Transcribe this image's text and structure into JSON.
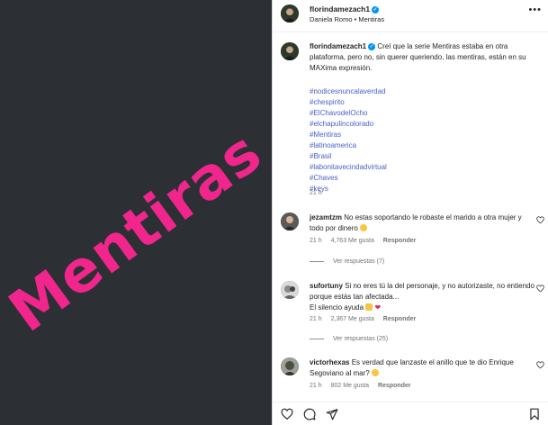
{
  "image_text": "Mentiras",
  "post": {
    "username": "florindamezach1",
    "subtitle": "Daniela Romo • Mentiras",
    "more": "•••"
  },
  "caption": {
    "username": "florindamezach1",
    "text": "Creí que la serie Mentiras estaba en otra plataforma, pero no, sin querer queriendo, las mentiras, están en su MAXima expresión.",
    "hashtags": [
      "#nodicesnuncalaverdad",
      "#chespirito",
      "#ElChavodelOcho",
      "#elchapulincolorado",
      "#Mentiras",
      "#latinoamerica",
      "#Brasil",
      "#labonitavecindadvirtual",
      "#Chaves",
      "#keys"
    ],
    "time": "21 h"
  },
  "comments": [
    {
      "username": "jezamtzm",
      "text": "No estas soportando le robaste el marido a otra mujer y todo por dinero",
      "time": "21 h",
      "likes": "4,763 Me gusta",
      "reply": "Responder",
      "replies": "Ver respuestas (7)"
    },
    {
      "username": "sufortuny",
      "text": "Si no eres tú la del personaje, y no autorizaste, no entiendo porque estás tan afectada...",
      "text2": "El silencio ayuda",
      "time": "21 h",
      "likes": "2,367 Me gusta",
      "reply": "Responder",
      "replies": "Ver respuestas (25)"
    },
    {
      "username": "victorhexas",
      "text": "Es verdad que lanzaste el anillo que te dio Enrique Segoviano al mar?",
      "time": "21 h",
      "likes": "802 Me gusta",
      "reply": "Responder"
    }
  ],
  "colors": {
    "accent": "#f0268c",
    "hashtag": "#4b61c9",
    "verified": "#0095f6",
    "left_bg": "#2c2f33"
  }
}
